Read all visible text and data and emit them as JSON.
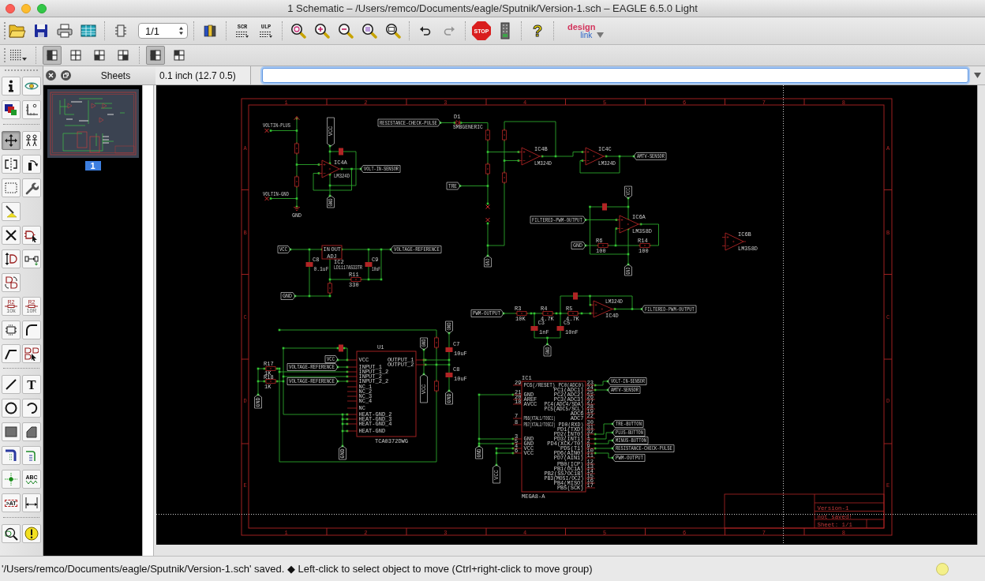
{
  "window": {
    "title": "1 Schematic – /Users/remco/Documents/eagle/Sputnik/Version-1.sch – EAGLE 6.5.0 Light"
  },
  "toolbar": {
    "items": [
      {
        "kind": "open",
        "disabled": false
      },
      {
        "kind": "save",
        "disabled": false
      },
      {
        "kind": "print",
        "disabled": false
      },
      {
        "kind": "cam",
        "disabled": false
      },
      {
        "kind": "separator"
      },
      {
        "kind": "board",
        "disabled": false
      },
      {
        "kind": "spinner",
        "value": "1/1"
      },
      {
        "kind": "separator"
      },
      {
        "kind": "library",
        "disabled": false
      },
      {
        "kind": "separator"
      },
      {
        "kind": "script",
        "label": "SCR",
        "disabled": false
      },
      {
        "kind": "ulp",
        "label": "ULP",
        "disabled": false
      },
      {
        "kind": "separator"
      },
      {
        "kind": "zoom_fit",
        "disabled": false
      },
      {
        "kind": "zoom_in",
        "disabled": false
      },
      {
        "kind": "zoom_out",
        "disabled": false
      },
      {
        "kind": "zoom_redraw",
        "disabled": false
      },
      {
        "kind": "zoom_select",
        "disabled": false
      },
      {
        "kind": "separator"
      },
      {
        "kind": "undo",
        "disabled": false
      },
      {
        "kind": "redo",
        "disabled": true
      },
      {
        "kind": "separator"
      },
      {
        "kind": "stop",
        "label": "STOP",
        "disabled": false
      },
      {
        "kind": "go",
        "disabled": false
      },
      {
        "kind": "separator"
      },
      {
        "kind": "help",
        "label": "?",
        "disabled": false
      },
      {
        "kind": "separator"
      },
      {
        "kind": "logo",
        "line1": "design",
        "line2": "link"
      }
    ]
  },
  "layout_toolbar": {
    "items": [
      {
        "kind": "grid"
      },
      {
        "kind": "separator"
      },
      {
        "kind": "quad_left",
        "selected": true
      },
      {
        "kind": "quad_none",
        "selected": false
      },
      {
        "kind": "quad_bottom_left",
        "selected": false
      },
      {
        "kind": "quad_bottom_right",
        "selected": false
      },
      {
        "kind": "separator"
      },
      {
        "kind": "quad_left",
        "selected": true
      },
      {
        "kind": "quad_top_left",
        "selected": false
      }
    ]
  },
  "left_toolbar": {
    "rows": [
      {
        "kind": "tools",
        "tools": [
          {
            "kind": "info",
            "selected": false
          },
          {
            "kind": "show",
            "selected": false
          }
        ]
      },
      {
        "kind": "tools",
        "tools": [
          {
            "kind": "display",
            "selected": false
          },
          {
            "kind": "mark",
            "selected": false
          }
        ]
      },
      {
        "kind": "separator"
      },
      {
        "kind": "tools",
        "tools": [
          {
            "kind": "move",
            "selected": true
          },
          {
            "kind": "copy",
            "selected": false
          }
        ]
      },
      {
        "kind": "tools",
        "tools": [
          {
            "kind": "mirror",
            "selected": false
          },
          {
            "kind": "rotate",
            "selected": false
          }
        ]
      },
      {
        "kind": "tools",
        "tools": [
          {
            "kind": "group",
            "selected": false
          },
          {
            "kind": "change",
            "selected": false
          }
        ]
      },
      {
        "kind": "tools",
        "tools": [
          {
            "kind": "paste",
            "selected": false
          }
        ]
      },
      {
        "kind": "tools",
        "tools": [
          {
            "kind": "delete",
            "selected": false
          },
          {
            "kind": "add",
            "selected": false
          }
        ]
      },
      {
        "kind": "tools",
        "tools": [
          {
            "kind": "pinswap",
            "selected": false
          },
          {
            "kind": "replace",
            "selected": false
          }
        ]
      },
      {
        "kind": "tools",
        "tools": [
          {
            "kind": "gateswap",
            "selected": false
          }
        ]
      },
      {
        "kind": "tools",
        "tools": [
          {
            "kind": "name",
            "selected": false,
            "lines": [
              "R2",
              "10k"
            ]
          },
          {
            "kind": "value",
            "selected": false,
            "lines": [
              "R2",
              "10R"
            ]
          }
        ]
      },
      {
        "kind": "tools",
        "tools": [
          {
            "kind": "smash",
            "selected": false
          },
          {
            "kind": "miter",
            "selected": false
          }
        ]
      },
      {
        "kind": "tools",
        "tools": [
          {
            "kind": "split",
            "selected": false
          },
          {
            "kind": "invoke",
            "selected": false
          }
        ]
      },
      {
        "kind": "separator"
      },
      {
        "kind": "tools",
        "tools": [
          {
            "kind": "wire",
            "selected": false
          },
          {
            "kind": "text",
            "selected": false,
            "label": "T"
          }
        ]
      },
      {
        "kind": "tools",
        "tools": [
          {
            "kind": "circle",
            "selected": false
          },
          {
            "kind": "arc",
            "selected": false
          }
        ]
      },
      {
        "kind": "tools",
        "tools": [
          {
            "kind": "rect",
            "selected": false
          },
          {
            "kind": "polygon",
            "selected": false
          }
        ]
      },
      {
        "kind": "tools",
        "tools": [
          {
            "kind": "bus",
            "selected": false
          },
          {
            "kind": "net",
            "selected": false
          }
        ]
      },
      {
        "kind": "tools",
        "tools": [
          {
            "kind": "junction",
            "selected": false
          },
          {
            "kind": "label",
            "selected": false,
            "label": "ABC"
          }
        ]
      },
      {
        "kind": "tools",
        "tools": [
          {
            "kind": "attribute",
            "selected": false,
            "label": ">AT"
          },
          {
            "kind": "dimension",
            "selected": false
          }
        ]
      },
      {
        "kind": "separator"
      },
      {
        "kind": "tools",
        "tools": [
          {
            "kind": "erc",
            "selected": false
          },
          {
            "kind": "errors",
            "selected": false
          }
        ]
      }
    ]
  },
  "sheets_panel": {
    "title": "Sheets",
    "sheets": [
      {
        "label": "1",
        "selected": true
      }
    ]
  },
  "coordinates": "0.1 inch (12.7 0.5)",
  "command_line": {
    "focused": true
  },
  "schematic": {
    "frame": {
      "top_columns": [
        "1",
        "2",
        "3",
        "4",
        "5",
        "6",
        "7",
        "8"
      ],
      "bottom_columns": [
        "1",
        "2",
        "3",
        "4",
        "5",
        "6",
        "7",
        "8"
      ],
      "left_rows": [
        "A",
        "B",
        "C",
        "D",
        "E"
      ],
      "right_rows": [
        "A",
        "B",
        "C",
        "D",
        "E"
      ]
    },
    "title_block": [
      "Version-1",
      "not saved!",
      "Sheet: 1/1"
    ],
    "texts": [
      "VOLTIN-PLUS",
      "VOLTIN-GND",
      "GND"
    ],
    "net_labels": [
      {
        "kind": "horizontal",
        "text": "RESISTANCE-CHECK-PULSE"
      },
      {
        "kind": "horizontal",
        "text": "VOLT-IN-SENSOR"
      },
      {
        "kind": "horizontal",
        "text": "AMTV-SENSOR"
      },
      {
        "kind": "horizontal",
        "text": "TRE"
      },
      {
        "kind": "horizontal",
        "text": "FILTERED-PWM-OUTPUT"
      },
      {
        "kind": "horizontal",
        "text": "GND"
      },
      {
        "kind": "horizontal",
        "text": "VCC"
      },
      {
        "kind": "horizontal",
        "text": "VOLTAGE-REFERENCE"
      },
      {
        "kind": "horizontal",
        "text": "GND"
      },
      {
        "kind": "horizontal",
        "text": "FILTERED-PWM-OUTPUT"
      },
      {
        "kind": "horizontal",
        "text": "PWM-OUTPUT"
      },
      {
        "kind": "horizontal",
        "text": "VCC"
      },
      {
        "kind": "horizontal",
        "text": "VOLTAGE-REFERENCE"
      },
      {
        "kind": "horizontal",
        "text": "VOLTAGE-REFERENCE"
      },
      {
        "kind": "horizontal",
        "text": "VOLT-IN-SENSOR"
      },
      {
        "kind": "horizontal",
        "text": "AMTV-SENSOR"
      },
      {
        "kind": "horizontal",
        "text": "TRE-BUTTON"
      },
      {
        "kind": "horizontal",
        "text": "PLUS-BUTTON"
      },
      {
        "kind": "horizontal",
        "text": "MINUS-BUTTON"
      },
      {
        "kind": "horizontal",
        "text": "RESISTANCE-CHECK-PULSE"
      },
      {
        "kind": "horizontal",
        "text": "PWM-OUTPUT"
      },
      {
        "kind": "vertical",
        "text": "VCC"
      },
      {
        "kind": "vertical",
        "text": "GND"
      },
      {
        "kind": "vertical",
        "text": "GND"
      },
      {
        "kind": "vertical",
        "text": "VCC"
      },
      {
        "kind": "vertical",
        "text": "GND"
      },
      {
        "kind": "vertical",
        "text": "GND"
      },
      {
        "kind": "vertical",
        "text": "GND"
      },
      {
        "kind": "vertical",
        "text": "GND"
      },
      {
        "kind": "vertical",
        "text": "VCC"
      },
      {
        "kind": "vertical",
        "text": "GND"
      },
      {
        "kind": "vertical",
        "text": "GND"
      },
      {
        "kind": "vertical",
        "text": "GND"
      },
      {
        "kind": "vertical",
        "text": "GND"
      },
      {
        "kind": "vertical",
        "text": "VCC"
      }
    ],
    "parts": [
      {
        "kind": "opamp",
        "name": "IC4A",
        "value": "LM324D"
      },
      {
        "kind": "opamp",
        "name": "IC4B",
        "value": "LM324D"
      },
      {
        "kind": "opamp",
        "name": "IC4C",
        "value": "LM324D"
      },
      {
        "kind": "opamp",
        "name": "IC6A",
        "value": "LM358D"
      },
      {
        "kind": "opamp",
        "name": "IC6B",
        "value": "LM358D"
      },
      {
        "kind": "opamp",
        "name": "IC4D",
        "value": "LM324D"
      },
      {
        "kind": "diode",
        "name": "D1",
        "value": "SMBGENERIC"
      },
      {
        "kind": "resistor",
        "name": "R11",
        "value": "330"
      },
      {
        "kind": "capacitor",
        "name": "C8",
        "value": "0.1uF"
      },
      {
        "kind": "capacitor",
        "name": "C9",
        "value": "10uF"
      },
      {
        "kind": "resistor",
        "name": "R6",
        "value": "100"
      },
      {
        "kind": "resistor",
        "name": "R14",
        "value": "100"
      },
      {
        "kind": "resistor",
        "name": "R3",
        "value": "10K"
      },
      {
        "kind": "resistor",
        "name": "R4",
        "value": "4.7K"
      },
      {
        "kind": "resistor",
        "name": "R5",
        "value": "4.7K"
      },
      {
        "kind": "capacitor",
        "name": "C3",
        "value": "1nF"
      },
      {
        "kind": "capacitor",
        "name": "C5",
        "value": "10nF"
      },
      {
        "kind": "resistor",
        "name": "R17",
        "value": "1K"
      },
      {
        "kind": "resistor",
        "name": "R18",
        "value": "1K"
      },
      {
        "kind": "capacitor",
        "name": "C7",
        "value": "10uF"
      },
      {
        "kind": "capacitor",
        "name": "C8",
        "value": "10uF"
      }
    ],
    "chips": [
      {
        "name": "IC2",
        "value": "LD1117AS33TR",
        "left_pins": [
          {
            "name": "IN"
          }
        ],
        "right_pins": [
          {
            "name": "OUT"
          }
        ],
        "bottom_pins": [
          {
            "name": "ADJ"
          }
        ]
      },
      {
        "name": "U1",
        "value": "TCA0372DWG",
        "left_pins": [
          {
            "name": "VCC"
          },
          {
            "name": "INPUT_1"
          },
          {
            "name": "INPUT_1_2"
          },
          {
            "name": "INPUT_2"
          },
          {
            "name": "INPUT_2_2"
          },
          {
            "name": "NC_1"
          },
          {
            "name": "NC_2"
          },
          {
            "name": "NC_3"
          },
          {
            "name": "NC_4"
          },
          {
            "name": "NC"
          },
          {
            "name": "HEAT-GND_2"
          },
          {
            "name": "HEAT-GND_3"
          },
          {
            "name": "HEAT-GND_4"
          },
          {
            "name": "HEAT-GND"
          }
        ],
        "right_pins": [
          {
            "name": "OUTPUT_1"
          },
          {
            "name": "OUTPUT_2"
          }
        ]
      },
      {
        "name": "IC1",
        "value": "MEGA8-A",
        "left_pins": [
          {
            "name": "PC6(/RESET)",
            "number": "29"
          },
          {
            "name": "GND",
            "number": "21"
          },
          {
            "name": "AREF",
            "number": "20"
          },
          {
            "name": "AVCC",
            "number": "18"
          },
          {
            "name": "PB6(XTAL1/TOSC1)",
            "number": "7"
          },
          {
            "name": "PB7(XTAL2/TOSC2)",
            "number": "8"
          },
          {
            "name": "GND",
            "number": "3"
          },
          {
            "name": "GND",
            "number": "5"
          },
          {
            "name": "VCC",
            "number": "4"
          },
          {
            "name": "VCC",
            "number": "6"
          }
        ],
        "right_pins": [
          {
            "name": "PC0(ADC0)",
            "number": "23"
          },
          {
            "name": "PC1(ADC1)",
            "number": "24"
          },
          {
            "name": "PC2(ADC2)",
            "number": "25"
          },
          {
            "name": "PC3(ADC3)",
            "number": "26"
          },
          {
            "name": "PC4(ADC4/SDA)",
            "number": "27"
          },
          {
            "name": "PC5(ADC5/SCL)",
            "number": "28"
          },
          {
            "name": "ADC6",
            "number": "19"
          },
          {
            "name": "ADC7",
            "number": "22"
          },
          {
            "name": "PD0(RXD)",
            "number": "30"
          },
          {
            "name": "PD1(TXD)",
            "number": "31"
          },
          {
            "name": "PD2(INT0)",
            "number": "32"
          },
          {
            "name": "PD3(INT1)",
            "number": "1"
          },
          {
            "name": "PD4(XCK/T0)",
            "number": "2"
          },
          {
            "name": "PD5(T1)",
            "number": "9"
          },
          {
            "name": "PD6(AIN0)",
            "number": "10"
          },
          {
            "name": "PD7(AIN1)",
            "number": "11"
          },
          {
            "name": "PB0(ICP)",
            "number": "12"
          },
          {
            "name": "PB1(OC1A)",
            "number": "13"
          },
          {
            "name": "PB2(SS/OC1B)",
            "number": "14"
          },
          {
            "name": "PB3(MOSI/OC2)",
            "number": "15"
          },
          {
            "name": "PB4(MISO)",
            "number": "16"
          },
          {
            "name": "PB5(SCK)",
            "number": "17"
          }
        ]
      }
    ]
  },
  "status_bar": {
    "message": "'/Users/remco/Documents/eagle/Sputnik/Version-1.sch' saved. ◆ Left-click to select object to move (Ctrl+right-click to move group)"
  }
}
